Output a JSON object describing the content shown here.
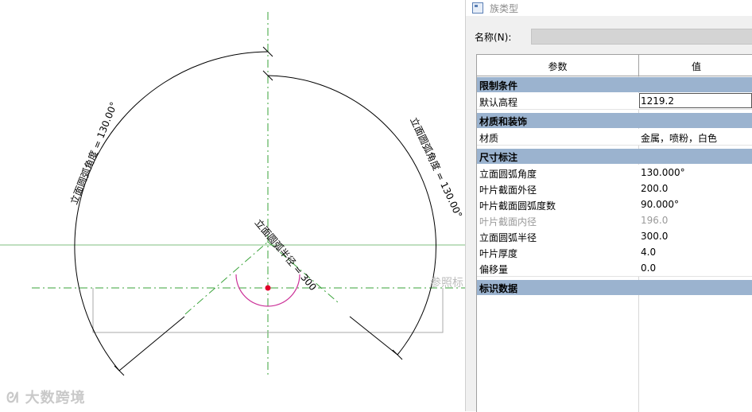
{
  "canvas": {
    "dim_left_label": "立面圆弧角度 = 130.00°",
    "dim_right_label": "立面圆弧角度 = 130.00°",
    "dim_radius_label": "立面圆弧半径 = 300",
    "ref_plane_label": "参照标",
    "watermark": "大数跨境"
  },
  "panel": {
    "title": "族类型",
    "name_label": "名称(N):",
    "name_value": "",
    "columns": {
      "param": "参数",
      "value": "值"
    },
    "groups": {
      "constraints": "限制条件",
      "materials": "材质和装饰",
      "dimensions": "尺寸标注",
      "identity": "标识数据"
    },
    "rows": {
      "default_elevation": {
        "label": "默认高程",
        "value": "1219.2"
      },
      "material": {
        "label": "材质",
        "value": "金属，喷粉，白色"
      },
      "arc_angle": {
        "label": "立面圆弧角度",
        "value": "130.000°"
      },
      "blade_outer_radius": {
        "label": "叶片截面外径",
        "value": "200.0"
      },
      "blade_arc_degree": {
        "label": "叶片截面圆弧度数",
        "value": "90.000°"
      },
      "blade_inner_radius": {
        "label": "叶片截面内径",
        "value": "196.0"
      },
      "arc_radius": {
        "label": "立面圆弧半径",
        "value": "300.0"
      },
      "blade_thickness": {
        "label": "叶片厚度",
        "value": "4.0"
      },
      "offset": {
        "label": "偏移量",
        "value": "0.0"
      }
    }
  },
  "colors": {
    "group_header": "#9bb3cf",
    "ref_line": "#3aa33a",
    "arc_marker": "#cc3399",
    "point": "#e0002a"
  }
}
